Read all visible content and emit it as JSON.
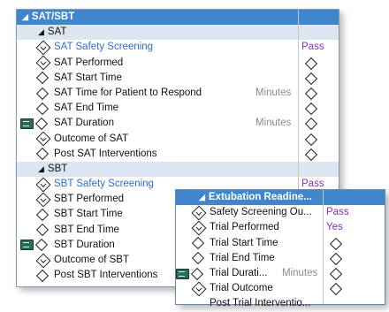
{
  "main": {
    "title": "SAT/SBT",
    "sections": [
      {
        "name": "SAT",
        "rows": [
          {
            "label": "SAT Safety Screening",
            "icon": "arrow",
            "blue": true,
            "value": "Pass"
          },
          {
            "label": "SAT Performed",
            "icon": "arrow",
            "value_diamond": true
          },
          {
            "label": "SAT Start Time",
            "icon": "diamond",
            "value_diamond": true
          },
          {
            "label": "SAT Time for Patient to Respond",
            "icon": "diamond",
            "unit": "Minutes",
            "value_diamond": true
          },
          {
            "label": "SAT End Time",
            "icon": "diamond",
            "value_diamond": true
          },
          {
            "label": "SAT Duration",
            "icon": "doc-diamond",
            "unit": "Minutes",
            "value_diamond": true
          },
          {
            "label": "Outcome of SAT",
            "icon": "arrow",
            "value_diamond": true
          },
          {
            "label": "Post SAT Interventions",
            "icon": "diamond",
            "value_diamond": true
          }
        ]
      },
      {
        "name": "SBT",
        "rows": [
          {
            "label": "SBT Safety Screening",
            "icon": "arrow",
            "blue": true,
            "value": "Pass"
          },
          {
            "label": "SBT Performed",
            "icon": "arrow"
          },
          {
            "label": "SBT Start Time",
            "icon": "diamond"
          },
          {
            "label": "SBT End Time",
            "icon": "diamond"
          },
          {
            "label": "SBT Duration",
            "icon": "doc-diamond"
          },
          {
            "label": "Outcome of SBT",
            "icon": "arrow"
          },
          {
            "label": "Post SBT Interventions",
            "icon": "diamond"
          }
        ]
      }
    ]
  },
  "popup": {
    "title": "Extubation Readine...",
    "rows": [
      {
        "label": "Safety Screening Ou...",
        "icon": "arrow",
        "value": "Pass"
      },
      {
        "label": "Trial Performed",
        "icon": "arrow",
        "value": "Yes"
      },
      {
        "label": "Trial Start Time",
        "icon": "diamond",
        "value_diamond": true
      },
      {
        "label": "Trial End Time",
        "icon": "diamond",
        "value_diamond": true
      },
      {
        "label": "Trial Durati...",
        "icon": "doc-diamond",
        "unit": "Minutes",
        "value_diamond": true
      },
      {
        "label": "Trial Outcome",
        "icon": "arrow",
        "value_diamond": true
      },
      {
        "label": "Post Trial Interventio...",
        "icon": "none"
      }
    ]
  },
  "colors": {
    "header": "#3f86cd",
    "pass": "#8a2fb8",
    "link_blue": "#2d6fd0"
  }
}
